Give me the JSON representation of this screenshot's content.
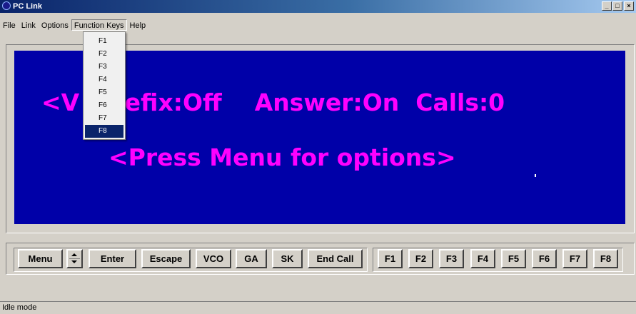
{
  "window": {
    "title": "PC Link",
    "controls": {
      "minimize": "_",
      "maximize": "□",
      "close": "×"
    }
  },
  "menubar": [
    {
      "label": "File"
    },
    {
      "label": "Link"
    },
    {
      "label": "Options"
    },
    {
      "label": "Function Keys",
      "open": true
    },
    {
      "label": "Help"
    }
  ],
  "function_keys_menu": {
    "items": [
      "F1",
      "F2",
      "F3",
      "F4",
      "F5",
      "F6",
      "F7",
      "F8"
    ],
    "selected": "F8"
  },
  "display": {
    "line1": "<V  Prefix:Off    Answer:On  Calls:0",
    "line2": "<Press Menu for options>",
    "background_color": "#0000a8",
    "text_color": "#ff00ff"
  },
  "buttons": {
    "menu": "Menu",
    "enter": "Enter",
    "escape": "Escape",
    "vco": "VCO",
    "ga": "GA",
    "sk": "SK",
    "end_call": "End Call",
    "function_keys": [
      "F1",
      "F2",
      "F3",
      "F4",
      "F5",
      "F6",
      "F7",
      "F8"
    ]
  },
  "status": {
    "text": "Idle mode"
  }
}
